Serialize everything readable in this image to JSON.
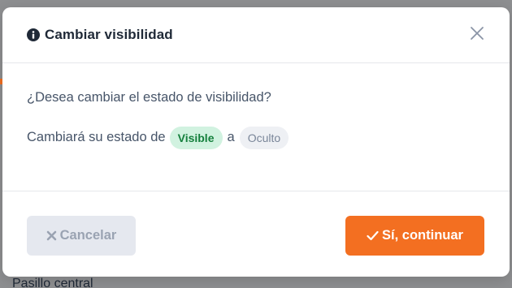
{
  "background": {
    "partial_text": "Pasillo central"
  },
  "modal": {
    "title": "Cambiar visibilidad",
    "question": "¿Desea cambiar el estado de visibilidad?",
    "state_prefix": "Cambiará su estado de",
    "from_state": "Visible",
    "connector": "a",
    "to_state": "Oculto",
    "cancel_label": "Cancelar",
    "confirm_label": "Sí, continuar"
  },
  "icons": {
    "title": "info-circle-icon",
    "close": "close-icon",
    "cancel": "times-icon",
    "confirm": "check-icon"
  },
  "colors": {
    "accent": "#f36f21",
    "visible_badge_bg": "#d1f2e0",
    "visible_badge_text": "#15803d",
    "hidden_badge_bg": "#eef0f4",
    "cancel_bg": "#e5e8ef"
  }
}
